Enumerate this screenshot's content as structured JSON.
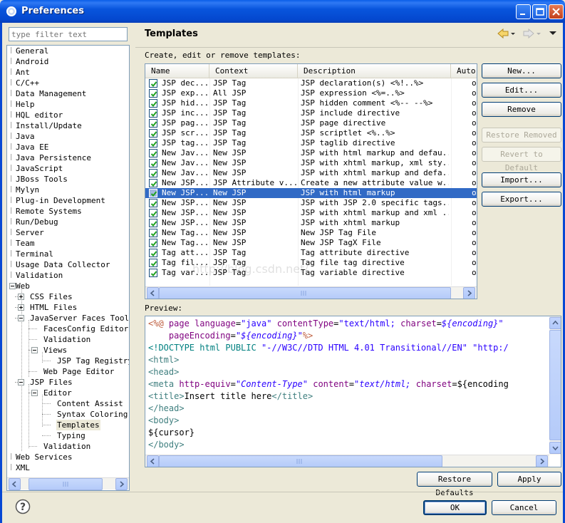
{
  "window": {
    "title": "Preferences"
  },
  "filter": {
    "placeholder": "type filter text"
  },
  "tree": [
    "General",
    "Android",
    "Ant",
    "C/C++",
    "Data Management",
    "Help",
    "HQL editor",
    "Install/Update",
    "Java",
    "Java EE",
    "Java Persistence",
    "JavaScript",
    "JBoss Tools",
    "Mylyn",
    "Plug-in Development",
    "Remote Systems",
    "Run/Debug",
    "Server",
    "Team",
    "Terminal",
    "Usage Data Collector",
    "Validation",
    "Web",
    "CSS Files",
    "HTML Files",
    "JavaServer Faces Tools",
    "FacesConfig Editor",
    "Validation",
    "Views",
    "JSP Tag Registry",
    "Web Page Editor",
    "JSP Files",
    "Editor",
    "Content Assist",
    "Syntax Coloring",
    "Templates",
    "Typing",
    "Validation",
    "Web Services",
    "XML"
  ],
  "page": {
    "title": "Templates",
    "description": "Create, edit or remove templates:",
    "preview_label": "Preview:"
  },
  "table": {
    "columns": [
      "Name",
      "Context",
      "Description",
      "Auto"
    ],
    "rows": [
      {
        "name": "JSP dec...",
        "context": "JSP Tag",
        "description": "JSP declaration(s) <%!..%>",
        "auto": "o"
      },
      {
        "name": "JSP exp...",
        "context": "All JSP",
        "description": "JSP expression <%=..%>",
        "auto": "o"
      },
      {
        "name": "JSP hid...",
        "context": "JSP Tag",
        "description": "JSP hidden comment <%-- --%>",
        "auto": "o"
      },
      {
        "name": "JSP inc...",
        "context": "JSP Tag",
        "description": "JSP include directive",
        "auto": "o"
      },
      {
        "name": "JSP pag...",
        "context": "JSP Tag",
        "description": "JSP page directive",
        "auto": "o"
      },
      {
        "name": "JSP scr...",
        "context": "JSP Tag",
        "description": "JSP scriptlet <%..%>",
        "auto": "o"
      },
      {
        "name": "JSP tag...",
        "context": "JSP Tag",
        "description": "JSP taglib directive",
        "auto": "o"
      },
      {
        "name": "New Jav...",
        "context": "New JSP",
        "description": "JSP with html markup and defau...",
        "auto": "o"
      },
      {
        "name": "New Jav...",
        "context": "New JSP",
        "description": "JSP with xhtml markup, xml sty...",
        "auto": "o"
      },
      {
        "name": "New Jav...",
        "context": "New JSP",
        "description": "JSP with xhtml markup and defa...",
        "auto": "o"
      },
      {
        "name": "New JSP...",
        "context": "JSP Attribute v...",
        "description": "Create a new attribute value w...",
        "auto": "o"
      },
      {
        "name": "New JSP...",
        "context": "New JSP",
        "description": "JSP with html markup",
        "auto": "o"
      },
      {
        "name": "New JSP...",
        "context": "New JSP",
        "description": "JSP with JSP 2.0 specific tags...",
        "auto": "o"
      },
      {
        "name": "New JSP...",
        "context": "New JSP",
        "description": "JSP with xhtml markup and xml ...",
        "auto": "o"
      },
      {
        "name": "New JSP...",
        "context": "New JSP",
        "description": "JSP with xhtml markup",
        "auto": "o"
      },
      {
        "name": "New Tag...",
        "context": "New JSP",
        "description": "New JSP Tag File",
        "auto": "o"
      },
      {
        "name": "New Tag...",
        "context": "New JSP",
        "description": "New JSP TagX File",
        "auto": "o"
      },
      {
        "name": "Tag att...",
        "context": "JSP Tag",
        "description": "Tag attribute directive",
        "auto": "o"
      },
      {
        "name": "Tag fil...",
        "context": "JSP Tag",
        "description": "Tag file tag directive",
        "auto": "o"
      },
      {
        "name": "Tag var...",
        "context": "JSP Tag",
        "description": "Tag variable directive",
        "auto": "o"
      }
    ]
  },
  "buttons": {
    "new": "New...",
    "edit": "Edit...",
    "remove": "Remove",
    "restore_removed": "Restore Removed",
    "revert_default": "Revert to Default",
    "import": "Import...",
    "export": "Export...",
    "restore_defaults": "Restore Defaults",
    "apply": "Apply",
    "ok": "OK",
    "cancel": "Cancel"
  },
  "watermark": "http://blog.csdn.net/",
  "preview": {
    "lines": [
      [
        [
          "jsp",
          "<%@"
        ],
        [
          "txt",
          " "
        ],
        [
          "attr",
          "page"
        ],
        [
          "txt",
          " "
        ],
        [
          "attr",
          "language"
        ],
        [
          "txt",
          "="
        ],
        [
          "str",
          "\"java\""
        ],
        [
          "txt",
          " "
        ],
        [
          "attr",
          "contentType"
        ],
        [
          "txt",
          "="
        ],
        [
          "str",
          "\"text/html; "
        ],
        [
          "attr",
          "charset"
        ],
        [
          "txt",
          "="
        ],
        [
          "var",
          "${encoding}"
        ],
        [
          "str",
          "\""
        ]
      ],
      [
        [
          "txt",
          "    "
        ],
        [
          "attr",
          "pageEncoding"
        ],
        [
          "txt",
          "="
        ],
        [
          "str",
          "\""
        ],
        [
          "var",
          "${encoding}"
        ],
        [
          "str",
          "\""
        ],
        [
          "jsp",
          "%>"
        ]
      ],
      [
        [
          "dt",
          "<!DOCTYPE html PUBLIC "
        ],
        [
          "str",
          "\"-//W3C//DTD HTML 4.01 Transitional//EN\""
        ],
        [
          "dt",
          " "
        ],
        [
          "str",
          "\"http:/"
        ]
      ],
      [
        [
          "tag",
          "<html>"
        ]
      ],
      [
        [
          "tag",
          "<head>"
        ]
      ],
      [
        [
          "tag",
          "<meta"
        ],
        [
          "txt",
          " "
        ],
        [
          "attr",
          "http-equiv"
        ],
        [
          "txt",
          "="
        ],
        [
          "var",
          "\"Content-Type\""
        ],
        [
          "txt",
          " "
        ],
        [
          "attr",
          "content"
        ],
        [
          "txt",
          "="
        ],
        [
          "var",
          "\"text/html; "
        ],
        [
          "attr",
          "charset"
        ],
        [
          "txt",
          "="
        ],
        [
          "txt",
          "${encoding"
        ]
      ],
      [
        [
          "tag",
          "<title>"
        ],
        [
          "txt",
          "Insert title here"
        ],
        [
          "tag",
          "</title>"
        ]
      ],
      [
        [
          "tag",
          "</head>"
        ]
      ],
      [
        [
          "tag",
          "<body>"
        ]
      ],
      [
        [
          "txt",
          "${cursor}"
        ]
      ],
      [
        [
          "tag",
          "</body>"
        ]
      ]
    ]
  },
  "colors": {
    "selection": "#316ac5",
    "titlebar": "#0a5ee8"
  }
}
